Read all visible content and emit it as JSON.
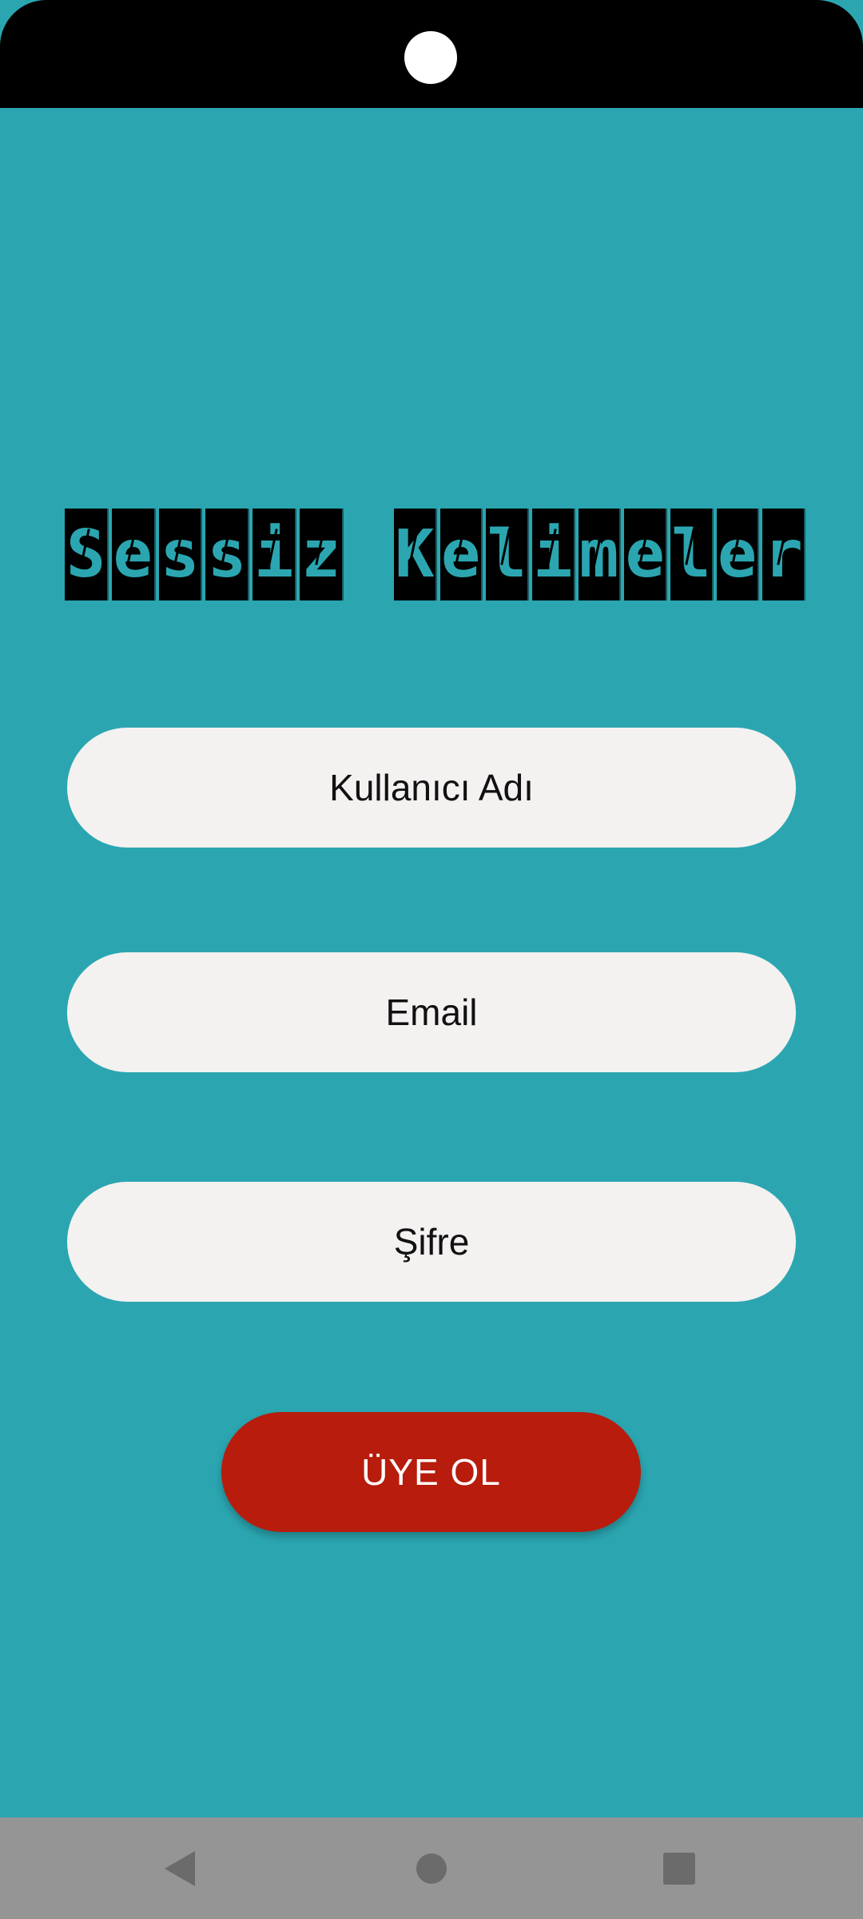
{
  "app": {
    "title_words": [
      "Sessiz",
      "Kelimeler"
    ],
    "title_letters_1": [
      "S",
      "e",
      "s",
      "s",
      "i",
      "z"
    ],
    "title_letters_2": [
      "K",
      "e",
      "l",
      "i",
      "m",
      "e",
      "l",
      "e",
      "r"
    ]
  },
  "form": {
    "username_placeholder": "Kullanıcı Adı",
    "email_placeholder": "Email",
    "password_placeholder": "Şifre",
    "submit_label": "ÜYE OL"
  },
  "colors": {
    "background": "#2ba6b1",
    "field_background": "#f4f1f1",
    "button_background": "#b81c0c",
    "button_text": "#ffffff",
    "logo_background": "#000000",
    "nav_bar": "#959595"
  },
  "nav": {
    "icons": [
      "back-icon",
      "home-icon",
      "recents-icon"
    ]
  }
}
